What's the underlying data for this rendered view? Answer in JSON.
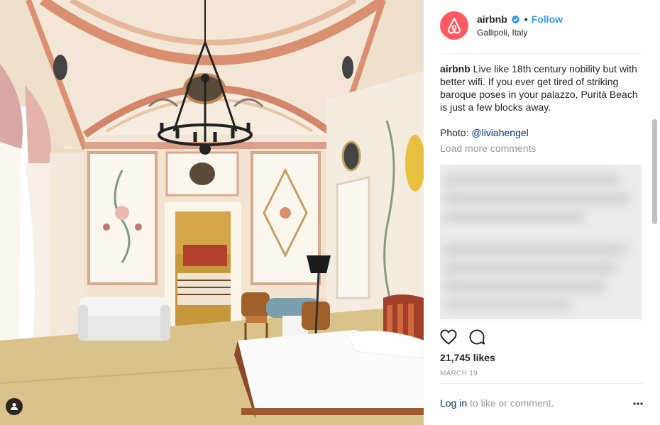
{
  "post": {
    "username": "airbnb",
    "follow_label": "Follow",
    "separator": "•",
    "location": "Gallipoli, Italy",
    "caption_user": "airbnb",
    "caption_text": "Live like 18th century nobility but with better wifi. If you ever get tired of striking baroque poses in your palazzo, Purità Beach is just a few blocks away.",
    "photo_prefix": "Photo: ",
    "photo_mention": "@liviahengel",
    "load_more": "Load more comments",
    "likes": "21,745 likes",
    "date": "MARCH 19",
    "login_link": "Log in",
    "login_rest": " to like or comment."
  },
  "icons": {
    "avatar": "airbnb-logo-icon",
    "verified": "verified-badge-icon",
    "like": "heart-icon",
    "comment": "comment-bubble-icon",
    "more": "more-options-icon",
    "tag": "user-tag-icon"
  },
  "colors": {
    "brand": "#ff5a5f",
    "link": "#3897f0",
    "mention": "#003569",
    "muted": "#999999",
    "divider": "#efefef"
  }
}
